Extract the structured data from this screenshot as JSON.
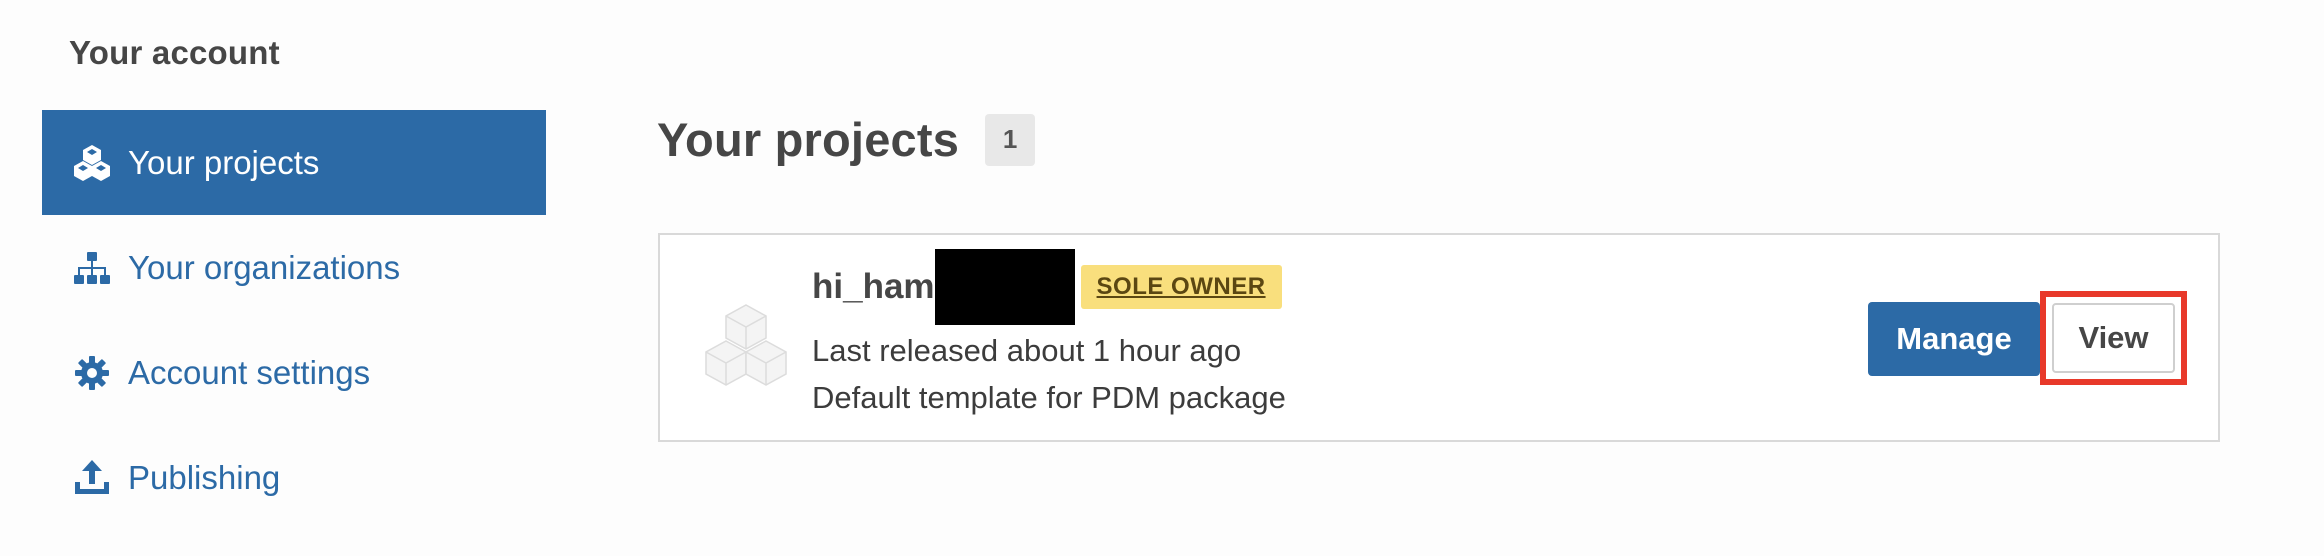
{
  "sidebar": {
    "title": "Your account",
    "items": [
      {
        "label": "Your projects",
        "icon": "cubes-icon",
        "active": true
      },
      {
        "label": "Your organizations",
        "icon": "sitemap-icon",
        "active": false
      },
      {
        "label": "Account settings",
        "icon": "gear-icon",
        "active": false
      },
      {
        "label": "Publishing",
        "icon": "upload-icon",
        "active": false
      }
    ]
  },
  "main": {
    "title": "Your projects",
    "count": "1",
    "projects": [
      {
        "name": "hi_ham",
        "role_badge": "SOLE OWNER",
        "last_released": "Last released about 1 hour ago",
        "description": "Default template for PDM package",
        "manage_label": "Manage",
        "view_label": "View"
      }
    ]
  },
  "colors": {
    "primary": "#2c6aa6",
    "badge": "#f9df7d",
    "highlight": "#e8392a"
  }
}
